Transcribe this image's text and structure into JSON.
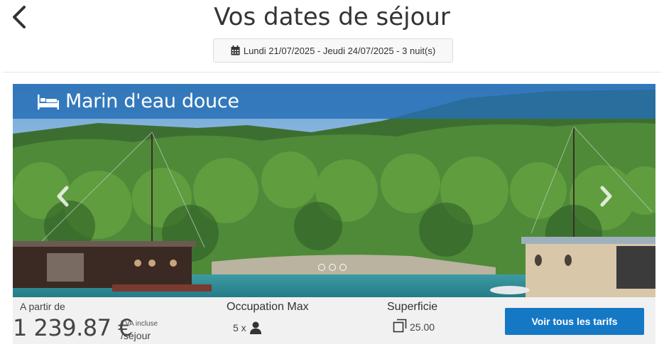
{
  "header": {
    "title": "Vos dates de séjour",
    "dates": "Lundi 21/07/2025 - Jeudi 24/07/2025 - 3 nuit(s)",
    "icons": {
      "back": "chevron-left-icon",
      "calendar": "calendar-icon"
    }
  },
  "card": {
    "name": "Marin d'eau douce",
    "icons": {
      "type": "bed-icon",
      "occupancy": "user-icon",
      "surface": "area-icon"
    },
    "carousel": {
      "slides": 3,
      "active": 1
    },
    "price_prefix": "A partir de",
    "price": "1 239.87 €",
    "tva": "TVA incluse",
    "per": "/séjour",
    "occupancy_label": "Occupation Max",
    "occupancy_value": "5 x",
    "surface_label": "Superficie",
    "surface_value": "25.00",
    "cta": "Voir tous les tarifs"
  },
  "colors": {
    "accent": "#1578c5",
    "name_bar": "#246eb4"
  }
}
